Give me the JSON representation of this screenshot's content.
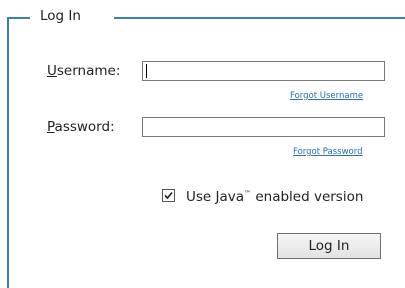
{
  "group": {
    "legend": "Log In"
  },
  "username": {
    "label_first": "U",
    "label_rest": "sername:",
    "value": "",
    "forgot_link": "Forgot Username"
  },
  "password": {
    "label_first": "P",
    "label_rest": "assword:",
    "value": "",
    "forgot_link": "Forgot Password"
  },
  "java_option": {
    "checked": true,
    "text_before": "Use ",
    "text_underlined": "J",
    "text_after_j": "ava",
    "trademark": "™",
    "text_end": " enabled version"
  },
  "submit": {
    "label": "Log In"
  },
  "colors": {
    "border": "#3a7fb8",
    "link": "#2a6fb5"
  }
}
